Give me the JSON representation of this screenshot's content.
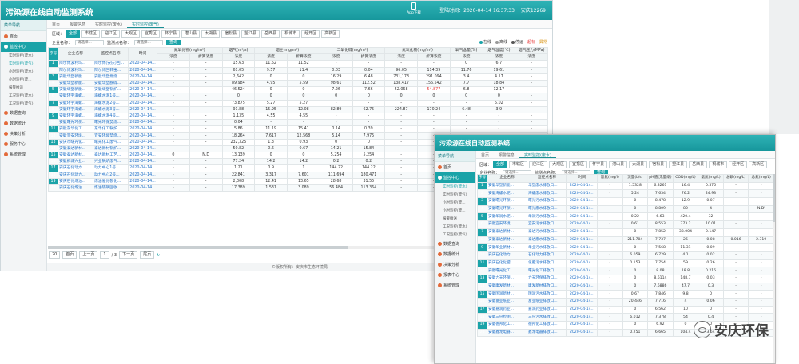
{
  "brand": "#1aa3a8",
  "w1": {
    "title": "污染源在线自动监测系统",
    "app": "App下载",
    "time": "登陆时间：2020-04-14 16:37:33",
    "user": "安庆12269",
    "side_header": "菜单导航",
    "side": [
      {
        "label": "首页",
        "active": false
      },
      {
        "label": "监控中心",
        "active": true
      }
    ],
    "subs": [
      "实时监控(废水)",
      "实时监控(废气)",
      "小时监控(废水)",
      "小时监控(废...",
      "报警推送",
      "工况监控(废水)",
      "工况监控(废气)"
    ],
    "side2": [
      "数据查询",
      "数据统计",
      "决策分析",
      "服务中心",
      "系统管理"
    ],
    "tabs": [
      "首页",
      "报警信息",
      "实时监控(废水)",
      "实时监控(废气)"
    ],
    "area_label": "区域：",
    "areas": [
      "全部",
      "市辖区",
      "迎江区",
      "大观区",
      "宜秀区",
      "怀宁县",
      "潜山县",
      "太湖县",
      "宿松县",
      "望江县",
      "岳西县",
      "桐城市",
      "经开区",
      "高新区"
    ],
    "ent_label": "企业名称：",
    "ent_value": "请选择...",
    "site_label": "监测点名称：",
    "site_value": "请选择...",
    "query": "查询",
    "legend": [
      "在线",
      "离线",
      "停运",
      "超标",
      "异常"
    ],
    "headers1": [
      "序号",
      "企业名称",
      "监控点名称",
      "时间",
      "氮氧化物(mg/m³)",
      "烟气(m³/s)",
      "烟尘(mg/m³)",
      "二氧化硫(mg/m³)",
      "氮氧化物(mg/m³)",
      "氧气含量(%)",
      "烟气温度(℃)",
      "烟气压力(MPa)"
    ],
    "headers2": [
      "浓度",
      "折算浓度",
      "浓度",
      "浓度",
      "折算浓度",
      "浓度",
      "折算浓度",
      "浓度",
      "折算浓度",
      "浓度",
      "浓度",
      "浓度"
    ],
    "rows": [
      [
        "1",
        "阿尔博波利玛...",
        "阿尔博(安庆)回...",
        "2020-04-14...",
        "-",
        "-",
        "15.63",
        "11.52",
        "11.52",
        "-",
        "-",
        "-",
        "-",
        "0",
        "6.7",
        "-"
      ],
      [
        "2",
        "阿尔博波利玛...",
        "阿尔博回转窑...",
        "2020-04-14...",
        "-",
        "-",
        "61.05",
        "9.57",
        "11.4",
        "0.03",
        "0.04",
        "96.05",
        "114.39",
        "11.76",
        "19.61",
        "-"
      ],
      [
        "3",
        "安徽华塑新能...",
        "安徽华塑燃烧...",
        "2020-04-14...",
        "-",
        "-",
        "2,642",
        "0",
        "0",
        "16.29",
        "6.48",
        "731,173",
        "291.094",
        "3.4",
        "4.17",
        "-"
      ],
      [
        "4",
        "安徽华塑新能...",
        "安徽华塑脱硫...",
        "2020-04-14...",
        "-",
        "-",
        "89,984",
        "4.95",
        "5.59",
        "98.61",
        "112.52",
        "138.417",
        "156.542",
        "7.7",
        "18.84",
        "-"
      ],
      [
        "5",
        "安徽华塑新能...",
        "安徽华塑锅炉...",
        "2020-04-14...",
        "-",
        "-",
        "46,524",
        "0",
        "0",
        "7.26",
        "7.66",
        "52.068",
        "54.877",
        "6.8",
        "12.17",
        "-"
      ],
      [
        "6",
        "安徽环宇海螺...",
        "海螺水泥1号...",
        "2020-04-14...",
        "-",
        "-",
        "0",
        "0",
        "0",
        "0",
        "0",
        "0",
        "0",
        "0",
        "0",
        "-"
      ],
      [
        "7",
        "安徽环宇海螺...",
        "海螺水泥2号...",
        "2020-04-14...",
        "-",
        "-",
        "73,875",
        "5.27",
        "5.27",
        "-",
        "-",
        "-",
        "-",
        "-",
        "5.02",
        "-"
      ],
      [
        "8",
        "安徽环宇海螺...",
        "海螺水泥3号...",
        "2020-04-14...",
        "-",
        "-",
        "91.88",
        "15.95",
        "12.08",
        "82.89",
        "62.75",
        "224.87",
        "170.24",
        "6.48",
        "3.9",
        "-"
      ],
      [
        "9",
        "安徽环宇海螺...",
        "海螺水泥4号...",
        "2020-04-14...",
        "-",
        "-",
        "1,135",
        "4.55",
        "4.55",
        "-",
        "-",
        "-",
        "-",
        "-",
        "-",
        "-"
      ],
      [
        "10",
        "安徽曙光环保...",
        "曙光环保焚烧...",
        "2020-04-14...",
        "-",
        "-",
        "0.04",
        "-",
        "-",
        "-",
        "-",
        "-",
        "-",
        "-",
        "-",
        "-"
      ],
      [
        "11",
        "安徽东华化工...",
        "东华化工锅炉...",
        "2020-04-14...",
        "-",
        "-",
        "5.86",
        "11.19",
        "15.41",
        "0.14",
        "0.39",
        "-",
        "-",
        "-",
        "-",
        "-"
      ],
      [
        "12",
        "安徽宜安环境...",
        "宜安环境焚烧...",
        "2020-04-14...",
        "-",
        "-",
        "18,264",
        "7.617",
        "12.568",
        "5.14",
        "7.975",
        "-",
        "-",
        "-",
        "-",
        "-"
      ],
      [
        "13",
        "安庆市曙光化...",
        "曙光化工废气...",
        "2020-04-14...",
        "-",
        "-",
        "232,325",
        "1.3",
        "0.93",
        "0",
        "0",
        "-",
        "-",
        "-",
        "-",
        "-"
      ],
      [
        "14",
        "安徽泰达新材...",
        "泰达新材锅炉...",
        "2020-04-14...",
        "-",
        "-",
        "50.82",
        "0.6",
        "0.67",
        "14.21",
        "15.84",
        "-",
        "-",
        "-",
        "-",
        "-"
      ],
      [
        "15",
        "安徽泰达新材...",
        "泰达新材工艺...",
        "2020-04-14...",
        "0",
        "N.D",
        "13,139",
        "0",
        "0",
        "5,254",
        "5,254",
        "-",
        "-",
        "-",
        "-",
        "-"
      ],
      [
        "16",
        "安徽桐城兴业...",
        "兴业锅炉废气...",
        "2020-04-14...",
        "-",
        "-",
        "77.24",
        "14.2",
        "14.2",
        "0.2",
        "0.2",
        "-",
        "-",
        "-",
        "-",
        "-"
      ],
      [
        "17",
        "安庆石化动力...",
        "动力中心1号...",
        "2020-04-14...",
        "-",
        "-",
        "1.21",
        "0.9",
        "1",
        "144.22",
        "144.22",
        "-",
        "-",
        "-",
        "-",
        "-"
      ],
      [
        "18",
        "安庆石化动力...",
        "动力中心2号...",
        "2020-04-14...",
        "-",
        "-",
        "22,841",
        "3.317",
        "7.601",
        "111.694",
        "180.471",
        "-",
        "-",
        "-",
        "-",
        "-"
      ],
      [
        "19",
        "安庆石化炼油...",
        "炼油催化裂化...",
        "2020-04-14...",
        "-",
        "-",
        "2,008",
        "12.41",
        "13.65",
        "28.68",
        "31.55",
        "-",
        "-",
        "-",
        "-",
        "-"
      ],
      [
        "20",
        "安庆石化炼油...",
        "炼油硫磺回收...",
        "2020-04-14...",
        "-",
        "-",
        "17,389",
        "1.531",
        "3.089",
        "56.484",
        "113.364",
        "-",
        "-",
        "-",
        "-",
        "-"
      ]
    ],
    "pager": {
      "size": "20",
      "first": "首页",
      "prev": "上一页",
      "page": "1",
      "total": "/ 3",
      "next": "下一页",
      "last": "尾页"
    },
    "footer": "©版权所有：安庆市生态环境局"
  },
  "w2": {
    "title": "污染源在线自动监测系统",
    "side_header": "菜单导航",
    "side": [
      {
        "label": "首页",
        "active": false
      },
      {
        "label": "监控中心",
        "active": true
      }
    ],
    "subs": [
      "实时监控(废水)",
      "实时监控(废气)",
      "小时监控(废...",
      "小时监控(废...",
      "报警推送",
      "工况监控(废水)",
      "工况监控(废气)"
    ],
    "side2": [
      "数据查询",
      "数据统计",
      "决策分析",
      "报表中心",
      "系统管理"
    ],
    "tabs": [
      "首页",
      "报警信息",
      "实时监控(废水)"
    ],
    "area_label": "区域：",
    "areas": [
      "全部",
      "市辖区",
      "迎江区",
      "大观区",
      "宜秀区",
      "怀宁县",
      "潜山县",
      "太湖县",
      "宿松县",
      "望江县",
      "岳西县",
      "桐城市",
      "经开区",
      "高新区"
    ],
    "ent_label": "企业名称：",
    "ent_value": "请选择...",
    "site_label": "监测点名称：",
    "site_value": "请选择...",
    "query": "查询",
    "headers": [
      "序号",
      "企业名称",
      "监控点名称",
      "时间",
      "氨氮(mg/l)",
      "流量(L/s)",
      "pH值(无量纲)",
      "COD(mg/L)",
      "氨氮(mg/L)",
      "总磷(mg/L)",
      "总氮(mg/L)"
    ],
    "rows": [
      [
        "1",
        "安徽华塑新能...",
        "华塑废水排放口...",
        "2020-04-14...",
        "-",
        "1.5328",
        "6.8261",
        "16.4",
        "0.575",
        "-",
        "-"
      ],
      [
        "2",
        "安徽海螺水泥...",
        "海螺废水排放口...",
        "2020-04-14...",
        "-",
        "5.24",
        "7.634",
        "76.2",
        "24.93",
        "-",
        "-"
      ],
      [
        "3",
        "安徽曙光环保...",
        "曙光污水排放口...",
        "2020-04-14...",
        "-",
        "0",
        "8.478",
        "12.9",
        "0.07",
        "-",
        "-"
      ],
      [
        "4",
        "安徽曙光环保...",
        "曙光废水排放口...",
        "2020-04-14...",
        "-",
        "0",
        "8.809",
        "80",
        "4",
        "-",
        "N.D'"
      ],
      [
        "5",
        "安徽华润水泥...",
        "华润污水排放口...",
        "2020-04-14...",
        "-",
        "0.22",
        "6.63",
        "420.4",
        "32",
        "-",
        "-"
      ],
      [
        "6",
        "安徽宜安环境...",
        "宜安污水排放口...",
        "2020-04-14...",
        "-",
        "0.61",
        "8.553",
        "373.2",
        "10.01",
        "-",
        "-"
      ],
      [
        "7",
        "安徽泰达新材...",
        "泰达污水排放口...",
        "2020-04-14...",
        "-",
        "0",
        "7.852",
        "33.004",
        "0.147",
        "-",
        "-"
      ],
      [
        "8",
        "安徽泰达新材...",
        "泰达废水排放口...",
        "2020-04-14...",
        "-",
        "211.704",
        "7.737",
        "26",
        "0.08",
        "0.016",
        "2.319"
      ],
      [
        "9",
        "安徽华业新材...",
        "华业污水排放口...",
        "2020-04-14...",
        "-",
        "0",
        "7.568",
        "11.31",
        "0.09",
        "-",
        "-"
      ],
      [
        "10",
        "安庆石化动力...",
        "石化动力排放口...",
        "2020-04-14...",
        "-",
        "6.059",
        "6.729",
        "4.1",
        "0.02",
        "-",
        "-"
      ],
      [
        "11",
        "安庆石化化肥...",
        "化肥污水排放口...",
        "2020-04-14...",
        "-",
        "0.153",
        "7.754",
        "59",
        "0.26",
        "-",
        "-"
      ],
      [
        "12",
        "安徽曙光化工...",
        "曙光化工排放口...",
        "2020-04-14...",
        "-",
        "0",
        "8.08",
        "18.8",
        "0.216",
        "-",
        "-"
      ],
      [
        "13",
        "安徽力天环保...",
        "力天环保排放口...",
        "2020-04-14...",
        "-",
        "0",
        "8.6114",
        "148.7",
        "0.03",
        "-",
        "-"
      ],
      [
        "14",
        "安徽康发新材...",
        "康发新材排放口...",
        "2020-04-14...",
        "-",
        "0",
        "7.6886",
        "47.7",
        "0.3",
        "-",
        "-"
      ],
      [
        "15",
        "安徽国润新材...",
        "国润污水排放口...",
        "2020-04-14...",
        "-",
        "0.67",
        "7.846",
        "9.8",
        "0",
        "-",
        "-"
      ],
      [
        "16",
        "安徽富亚纸业...",
        "富亚纸业排放口...",
        "2020-04-14...",
        "-",
        "20.446",
        "7.716",
        "4",
        "0.06",
        "-",
        "-"
      ],
      [
        "17",
        "安徽嘉润药业...",
        "嘉润药业排放口...",
        "2020-04-14...",
        "-",
        "0",
        "6.562",
        "10",
        "0",
        "-",
        "-"
      ],
      [
        "18",
        "安徽三兴检测...",
        "三兴污水排放口...",
        "2020-04-14...",
        "-",
        "6.012",
        "7.378",
        "54",
        "0.4",
        "-",
        "-"
      ],
      [
        "19",
        "安徽德邦化工...",
        "德邦化工排放口...",
        "2020-04-14...",
        "-",
        "0",
        "6.92",
        "0",
        "0",
        "-",
        "-"
      ],
      [
        "20",
        "安徽鑫龙电器...",
        "鑫龙电器排放口...",
        "2020-04-14...",
        "-",
        "0.251",
        "6.665",
        "104.4",
        "3.64",
        "-",
        "-"
      ]
    ]
  },
  "watermark": "安庆环保"
}
